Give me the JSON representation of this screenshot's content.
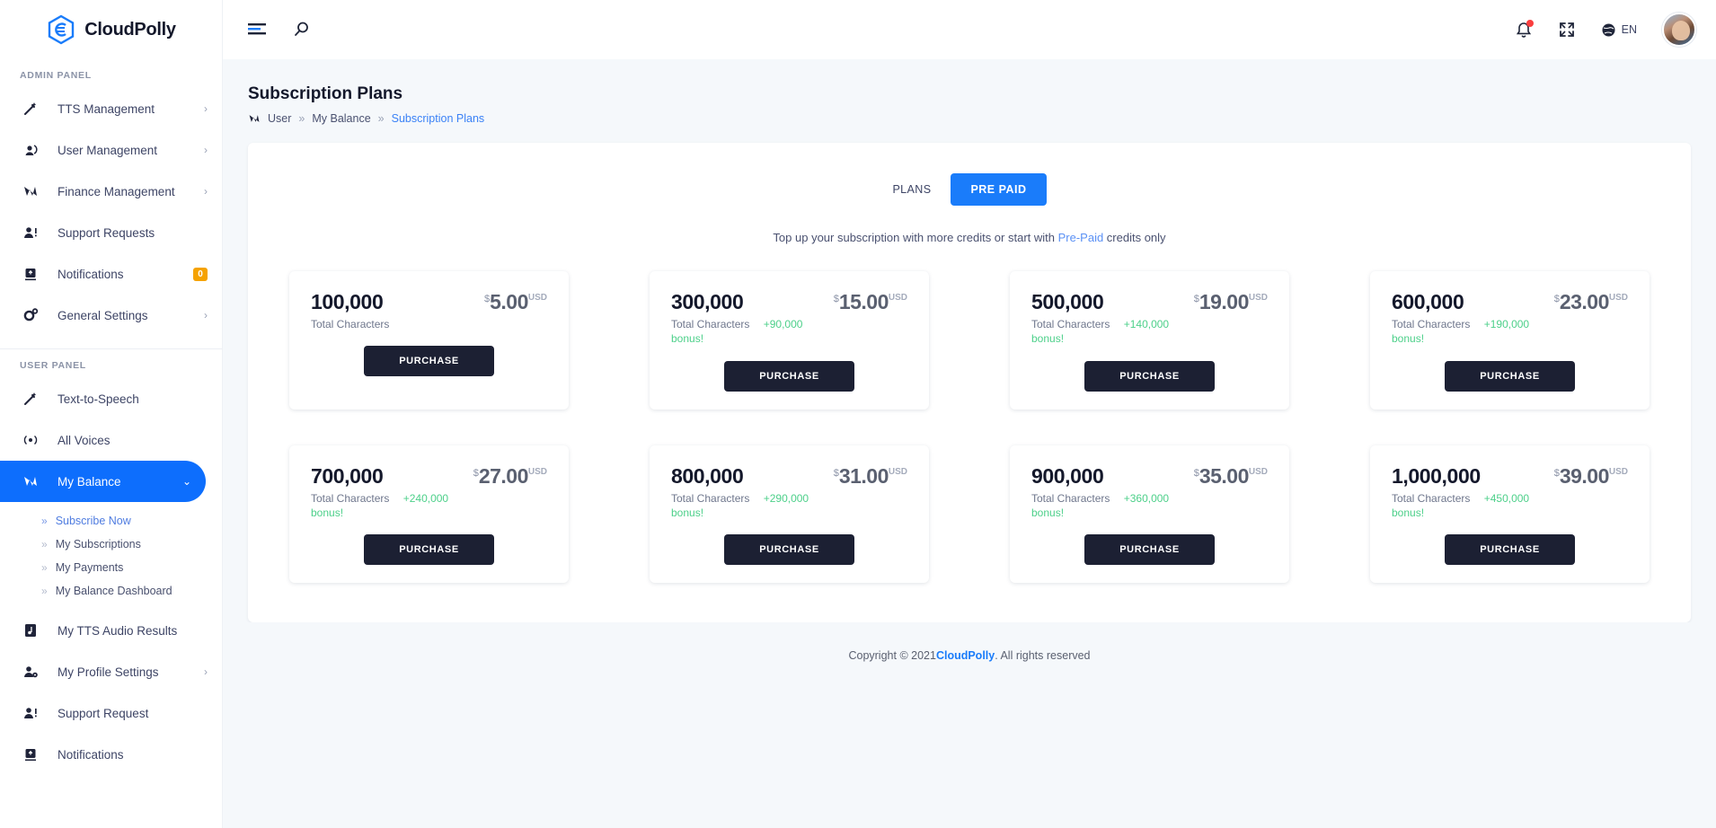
{
  "brand": {
    "name": "CloudPolly",
    "logo_icon": "cloudpolly-hexagon-logo"
  },
  "sidebar": {
    "admin_section_label": "ADMIN PANEL",
    "user_section_label": "USER PANEL",
    "admin_items": [
      {
        "label": "TTS Management",
        "icon": "magic-wand-icon",
        "chevron": "›"
      },
      {
        "label": "User Management",
        "icon": "user-voice-icon",
        "chevron": "›"
      },
      {
        "label": "Finance Management",
        "icon": "finance-chart-icon",
        "chevron": "›"
      },
      {
        "label": "Support Requests",
        "icon": "user-support-icon",
        "chevron": ""
      },
      {
        "label": "Notifications",
        "icon": "notification-box-icon",
        "chevron": "",
        "badge": "0"
      },
      {
        "label": "General Settings",
        "icon": "gear-icon",
        "chevron": "›"
      }
    ],
    "user_items": [
      {
        "label": "Text-to-Speech",
        "icon": "magic-wand-icon",
        "chevron": ""
      },
      {
        "label": "All Voices",
        "icon": "broadcast-icon",
        "chevron": ""
      },
      {
        "label": "My Balance",
        "icon": "finance-chart-icon",
        "chevron": "⌄",
        "active": true
      }
    ],
    "my_balance_children": [
      {
        "label": "Subscribe Now",
        "selected": true
      },
      {
        "label": "My Subscriptions",
        "selected": false
      },
      {
        "label": "My Payments",
        "selected": false
      },
      {
        "label": "My Balance Dashboard",
        "selected": false
      }
    ],
    "user_items_rest": [
      {
        "label": "My TTS Audio Results",
        "icon": "audio-file-icon",
        "chevron": ""
      },
      {
        "label": "My Profile Settings",
        "icon": "user-settings-icon",
        "chevron": "›"
      },
      {
        "label": "Support Request",
        "icon": "user-support-icon",
        "chevron": ""
      },
      {
        "label": "Notifications",
        "icon": "notification-box-icon",
        "chevron": ""
      }
    ]
  },
  "topbar": {
    "menu_icon": "hamburger-menu-icon",
    "search_icon": "search-icon",
    "bell_icon": "bell-icon",
    "fullscreen_icon": "fullscreen-expand-icon",
    "globe_icon": "globe-icon",
    "language": "EN",
    "avatar_icon": "user-avatar"
  },
  "page": {
    "title": "Subscription Plans",
    "breadcrumb_icon": "finance-chart-icon",
    "breadcrumb": [
      {
        "label": "User",
        "current": false
      },
      {
        "label": "My Balance",
        "current": false
      },
      {
        "label": "Subscription Plans",
        "current": true
      }
    ],
    "breadcrumb_separator": "»"
  },
  "plans_panel": {
    "toggle_plans_label": "PLANS",
    "toggle_prepaid_label": "PRE PAID",
    "subtitle_before": "Top up your subscription with more credits or start with ",
    "subtitle_link": "Pre-Paid",
    "subtitle_after": " credits only",
    "total_characters_label": "Total Characters",
    "bonus_suffix": "bonus!",
    "currency_symbol": "$",
    "currency_code": "USD",
    "purchase_label": "PURCHASE",
    "cards": [
      {
        "characters": "100,000",
        "price": "5.00",
        "bonus": ""
      },
      {
        "characters": "300,000",
        "price": "15.00",
        "bonus": "+90,000"
      },
      {
        "characters": "500,000",
        "price": "19.00",
        "bonus": "+140,000"
      },
      {
        "characters": "600,000",
        "price": "23.00",
        "bonus": "+190,000"
      },
      {
        "characters": "700,000",
        "price": "27.00",
        "bonus": "+240,000"
      },
      {
        "characters": "800,000",
        "price": "31.00",
        "bonus": "+290,000"
      },
      {
        "characters": "900,000",
        "price": "35.00",
        "bonus": "+360,000"
      },
      {
        "characters": "1,000,000",
        "price": "39.00",
        "bonus": "+450,000"
      }
    ]
  },
  "footer": {
    "before": "Copyright © 2021 ",
    "brand": "CloudPolly",
    "after": ". All rights reserved"
  },
  "colors": {
    "accent": "#1a7cfa",
    "link": "#3b82f6",
    "bonus_green": "#4dd08a",
    "badge_orange": "#f5a200",
    "dark_button": "#1c2033"
  }
}
